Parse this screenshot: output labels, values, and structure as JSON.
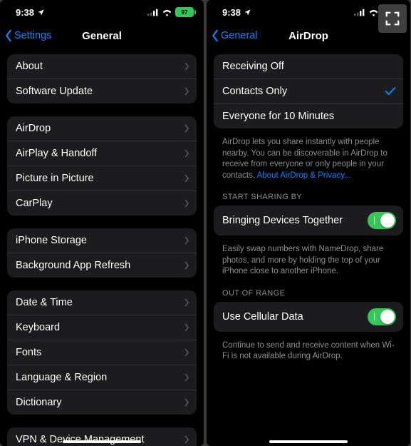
{
  "statusbar": {
    "time": "9:38",
    "battery_pct": "97"
  },
  "left": {
    "back": "Settings",
    "title": "General",
    "groups": [
      {
        "rows": [
          {
            "label": "About",
            "name": "row-about"
          },
          {
            "label": "Software Update",
            "name": "row-software-update"
          }
        ]
      },
      {
        "rows": [
          {
            "label": "AirDrop",
            "name": "row-airdrop"
          },
          {
            "label": "AirPlay & Handoff",
            "name": "row-airplay-handoff"
          },
          {
            "label": "Picture in Picture",
            "name": "row-picture-in-picture"
          },
          {
            "label": "CarPlay",
            "name": "row-carplay"
          }
        ]
      },
      {
        "rows": [
          {
            "label": "iPhone Storage",
            "name": "row-iphone-storage"
          },
          {
            "label": "Background App Refresh",
            "name": "row-background-app-refresh"
          }
        ]
      },
      {
        "rows": [
          {
            "label": "Date & Time",
            "name": "row-date-time"
          },
          {
            "label": "Keyboard",
            "name": "row-keyboard"
          },
          {
            "label": "Fonts",
            "name": "row-fonts"
          },
          {
            "label": "Language & Region",
            "name": "row-language-region"
          },
          {
            "label": "Dictionary",
            "name": "row-dictionary"
          }
        ]
      },
      {
        "rows": [
          {
            "label": "VPN & Device Management",
            "name": "row-vpn-device-management"
          }
        ]
      }
    ]
  },
  "right": {
    "back": "General",
    "title": "AirDrop",
    "receiving": {
      "options": [
        {
          "label": "Receiving Off",
          "name": "row-receiving-off",
          "selected": false
        },
        {
          "label": "Contacts Only",
          "name": "row-contacts-only",
          "selected": true
        },
        {
          "label": "Everyone for 10 Minutes",
          "name": "row-everyone-10-minutes",
          "selected": false
        }
      ],
      "footer_text": "AirDrop lets you share instantly with people nearby. You can be discoverable in AirDrop to receive from everyone or only people in your contacts. ",
      "footer_link": "About AirDrop & Privacy..."
    },
    "section1": {
      "header": "START SHARING BY",
      "row_label": "Bringing Devices Together",
      "row_name": "row-bringing-devices-together",
      "footer": "Easily swap numbers with NameDrop, share photos, and more by holding the top of your iPhone close to another iPhone."
    },
    "section2": {
      "header": "OUT OF RANGE",
      "row_label": "Use Cellular Data",
      "row_name": "row-use-cellular-data",
      "footer": "Continue to send and receive content when Wi-Fi is not available during AirDrop."
    }
  }
}
